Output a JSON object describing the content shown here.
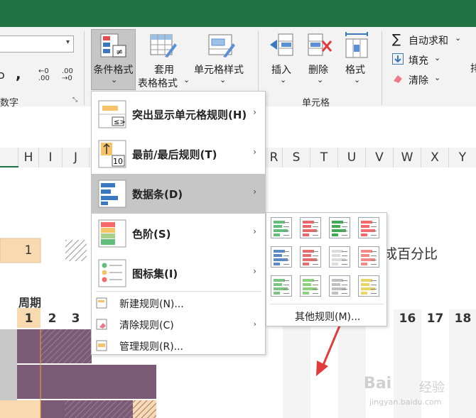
{
  "ribbon": {
    "number_glyphs": {
      "currency": "ɔ",
      "comma": ",",
      "inc_decimal": "←0\n.00",
      "dec_decimal": ".00\n→0"
    },
    "number_group_label": "数字",
    "cf_button": {
      "label": "条件格式",
      "arrow": "⌄"
    },
    "table_button": {
      "line1": "套用",
      "line2": "表格格式"
    },
    "cell_style_button": {
      "label": "单元格样式"
    },
    "insert_button": {
      "label": "插入"
    },
    "delete_button": {
      "label": "删除"
    },
    "format_button": {
      "label": "格式"
    },
    "cells_group_label": "单元格",
    "autosum": {
      "symbol": "∑",
      "label": "自动求和"
    },
    "fill": {
      "label": "填充"
    },
    "clear": {
      "label": "清除"
    },
    "edge_glyph": "排",
    "dropdown_glyph": "⌄"
  },
  "columns": [
    "H",
    "I",
    "J",
    "R",
    "S",
    "T",
    "U",
    "V",
    "W",
    "X",
    "Y"
  ],
  "sheet": {
    "cell_value": "1",
    "overlay_text": "成百分比",
    "period_label": "周期",
    "period_numbers": [
      "1",
      "2",
      "3"
    ],
    "period_numbers_right": [
      "16",
      "17",
      "18"
    ]
  },
  "menu": {
    "items": [
      {
        "label": "突出显示单元格规则(H)"
      },
      {
        "label": "最前/最后规则(T)"
      },
      {
        "label": "数据条(D)"
      },
      {
        "label": "色阶(S)"
      },
      {
        "label": "图标集(I)"
      }
    ],
    "small_items": [
      {
        "label": "新建规则(N)..."
      },
      {
        "label": "清除规则(C)"
      },
      {
        "label": "管理规则(R)..."
      }
    ],
    "chevron": "›"
  },
  "submenu": {
    "more_rules": "其他规则(M)...",
    "bar_colors": [
      "#63be7b",
      "#e8696b",
      "#3fab52",
      "#f8696b",
      "#5a8ac6",
      "#e36c6c",
      "#ffffff",
      "#f28a8a",
      "#7cc47f",
      "#8fd07e",
      "#c0c0c0",
      "#e9d46a"
    ]
  },
  "watermark": {
    "brand": "Bai",
    "brand2": "经验",
    "url": "jingyan.baidu.com"
  },
  "colors": {
    "excel_green": "#217346",
    "gantt_purple": "#7b5a75",
    "peach": "#f8d9b0",
    "arrow_red": "#e23b3b"
  }
}
